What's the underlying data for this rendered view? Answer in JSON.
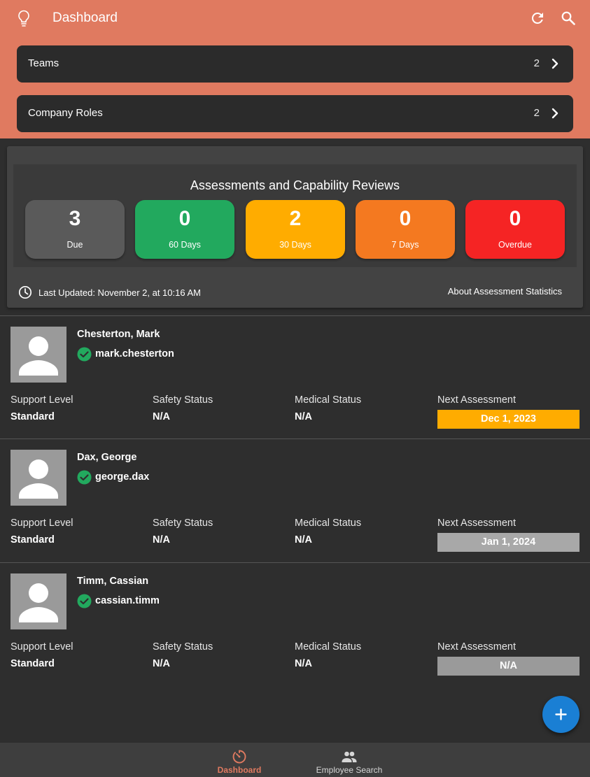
{
  "header": {
    "title": "Dashboard",
    "bulb_icon": "lightbulb-icon",
    "refresh_icon": "refresh-icon",
    "search_icon": "search-icon",
    "nav_cards": [
      {
        "label": "Teams",
        "count": "2"
      },
      {
        "label": "Company Roles",
        "count": "2"
      }
    ]
  },
  "stats": {
    "title": "Assessments and Capability Reviews",
    "tiles": [
      {
        "value": "3",
        "label": "Due",
        "color": "#5a5a5a"
      },
      {
        "value": "0",
        "label": "60 Days",
        "color": "#22a95e"
      },
      {
        "value": "2",
        "label": "30 Days",
        "color": "#ffac00"
      },
      {
        "value": "0",
        "label": "7 Days",
        "color": "#f47920"
      },
      {
        "value": "0",
        "label": "Overdue",
        "color": "#f52424"
      }
    ],
    "last_updated": "Last Updated: November 2, at 10:16 AM",
    "about_link": "About Assessment Statistics"
  },
  "employees": {
    "labels": {
      "support": "Support Level",
      "safety": "Safety Status",
      "medical": "Medical Status",
      "next": "Next Assessment"
    },
    "rows": [
      {
        "name": "Chesterton, Mark",
        "username": "mark.chesterton",
        "support": "Standard",
        "safety": "N/A",
        "medical": "N/A",
        "next": "Dec 1, 2023",
        "next_color": "#ffac00"
      },
      {
        "name": "Dax, George",
        "username": "george.dax",
        "support": "Standard",
        "safety": "N/A",
        "medical": "N/A",
        "next": "Jan 1, 2024",
        "next_color": "#a8a8a8"
      },
      {
        "name": "Timm, Cassian",
        "username": "cassian.timm",
        "support": "Standard",
        "safety": "N/A",
        "medical": "N/A",
        "next": "N/A",
        "next_color": "#9a9a9a"
      }
    ]
  },
  "fab": {
    "icon": "plus-icon",
    "color": "#1a7fd4"
  },
  "bottom_nav": {
    "items": [
      {
        "label": "Dashboard",
        "icon": "dashboard-icon",
        "active": true
      },
      {
        "label": "Employee Search",
        "icon": "people-icon",
        "active": false
      }
    ]
  },
  "colors": {
    "accent": "#e07a60",
    "background": "#2e2e2e",
    "verified": "#22a95e"
  }
}
